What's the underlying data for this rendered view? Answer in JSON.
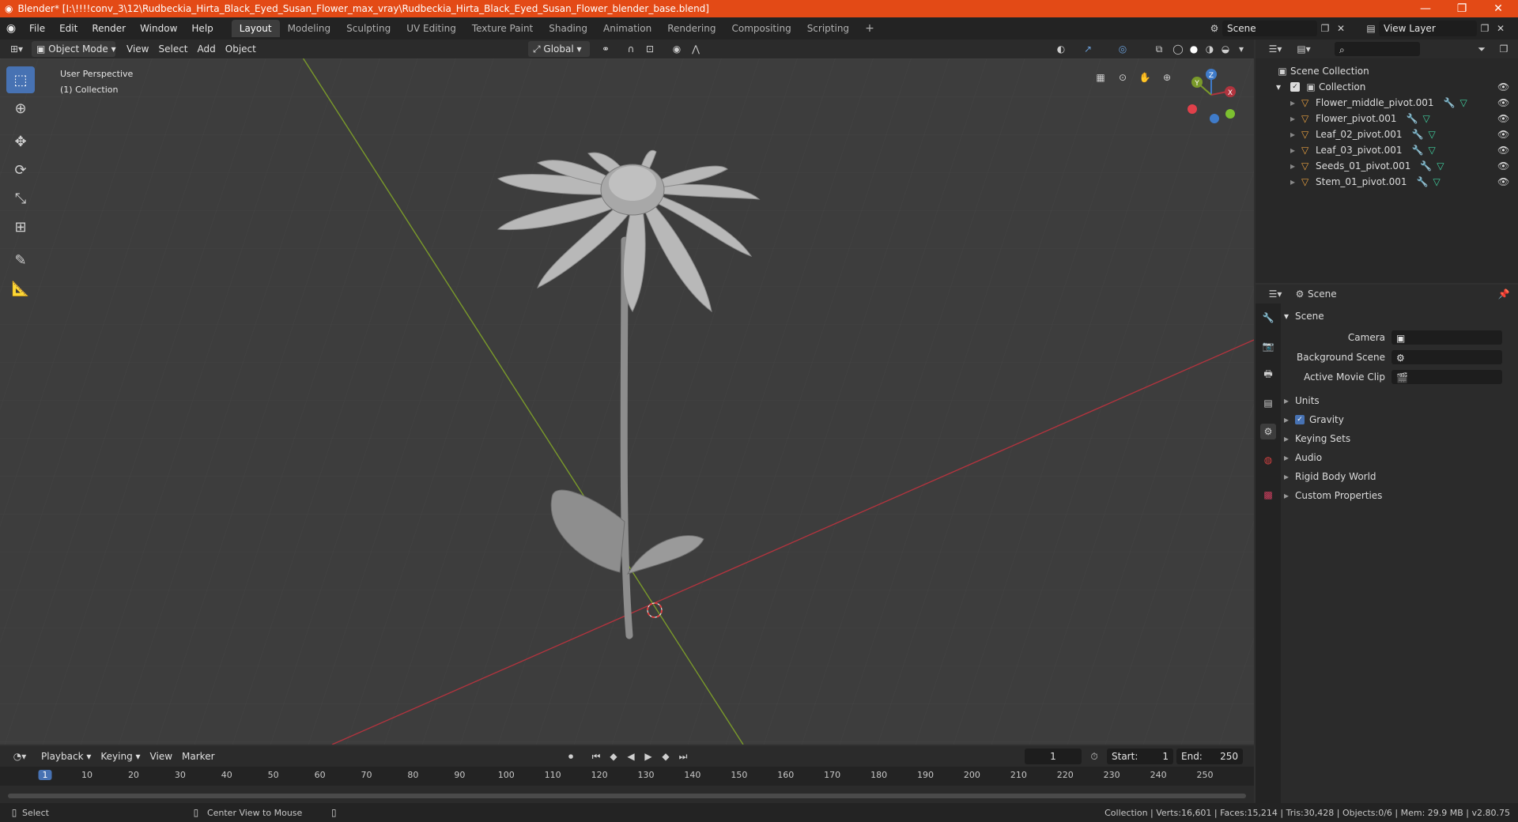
{
  "window": {
    "title": "Blender* [I:\\!!!!conv_3\\12\\Rudbeckia_Hirta_Black_Eyed_Susan_Flower_max_vray\\Rudbeckia_Hirta_Black_Eyed_Susan_Flower_blender_base.blend]",
    "minimize": "—",
    "maximize": "❐",
    "close": "✕"
  },
  "menus": [
    "File",
    "Edit",
    "Render",
    "Window",
    "Help"
  ],
  "workspaces": [
    "Layout",
    "Modeling",
    "Sculpting",
    "UV Editing",
    "Texture Paint",
    "Shading",
    "Animation",
    "Rendering",
    "Compositing",
    "Scripting"
  ],
  "workspace_add": "+",
  "scene_field": "Scene",
  "view_layer_field": "View Layer",
  "viewport_header": {
    "mode": "Object Mode",
    "menus": [
      "View",
      "Select",
      "Add",
      "Object"
    ],
    "orientation": "Global"
  },
  "viewport": {
    "perspective": "User Perspective",
    "collection": "(1) Collection"
  },
  "gizmo": {
    "x": "X",
    "y": "Y",
    "z": "Z"
  },
  "outliner": {
    "root": "Scene Collection",
    "collection": "Collection",
    "items": [
      "Flower_middle_pivot.001",
      "Flower_pivot.001",
      "Leaf_02_pivot.001",
      "Leaf_03_pivot.001",
      "Seeds_01_pivot.001",
      "Stem_01_pivot.001"
    ]
  },
  "properties": {
    "header": "Scene",
    "section": "Scene",
    "fields": [
      "Camera",
      "Background Scene",
      "Active Movie Clip"
    ],
    "panels": [
      "Units",
      "Gravity",
      "Keying Sets",
      "Audio",
      "Rigid Body World",
      "Custom Properties"
    ]
  },
  "timeline": {
    "menus": [
      "Playback",
      "Keying",
      "View",
      "Marker"
    ],
    "current_frame": "1",
    "start_label": "Start:",
    "start": "1",
    "end_label": "End:",
    "end": "250",
    "ticks": [
      "1",
      "10",
      "20",
      "30",
      "40",
      "50",
      "60",
      "70",
      "80",
      "90",
      "100",
      "110",
      "120",
      "130",
      "140",
      "150",
      "160",
      "170",
      "180",
      "190",
      "200",
      "210",
      "220",
      "230",
      "240",
      "250"
    ]
  },
  "statusbar": {
    "left": "Select",
    "middle": "Center View to Mouse",
    "stats": "Collection | Verts:16,601 | Faces:15,214 | Tris:30,428 | Objects:0/6 | Mem: 29.9 MB | v2.80.75"
  },
  "colors": {
    "title_bar": "#e34a16",
    "active_tool": "#4772b3",
    "x_axis": "#b0343e",
    "y_axis": "#7a9a2a"
  }
}
